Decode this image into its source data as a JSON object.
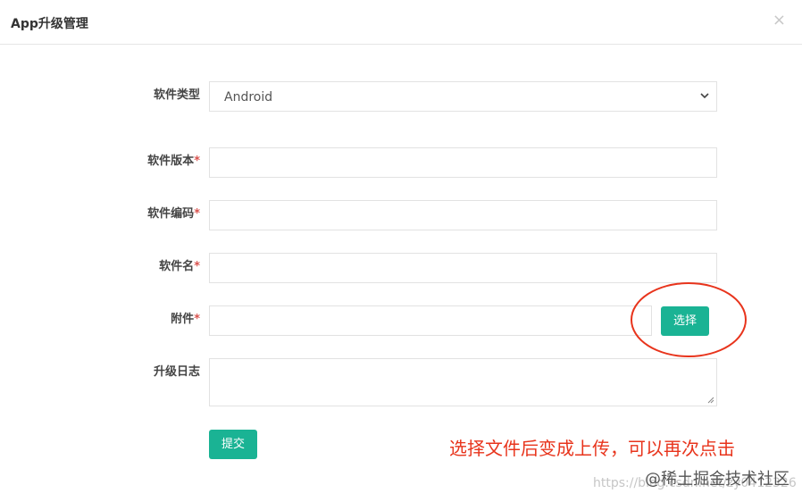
{
  "dialog": {
    "title": "App升级管理",
    "close_glyph": "×"
  },
  "form": {
    "type": {
      "label": "软件类型",
      "value": "Android"
    },
    "version": {
      "label": "软件版本",
      "required_mark": "*",
      "value": ""
    },
    "code": {
      "label": "软件编码",
      "required_mark": "*",
      "value": ""
    },
    "name": {
      "label": "软件名",
      "required_mark": "*",
      "value": ""
    },
    "attachment": {
      "label": "附件",
      "required_mark": "*",
      "value": "",
      "choose_button": "选择"
    },
    "log": {
      "label": "升级日志",
      "value": ""
    },
    "submit_button": "提交"
  },
  "annotation": {
    "text": "选择文件后变成上传，可以再次点击",
    "color": "#e8341c"
  },
  "watermark": {
    "url": "https://blog.csdn.net/zy0412326",
    "brand": "@稀土掘金技术社区"
  },
  "colors": {
    "primary_button": "#1ab394",
    "required": "#d9534f"
  }
}
